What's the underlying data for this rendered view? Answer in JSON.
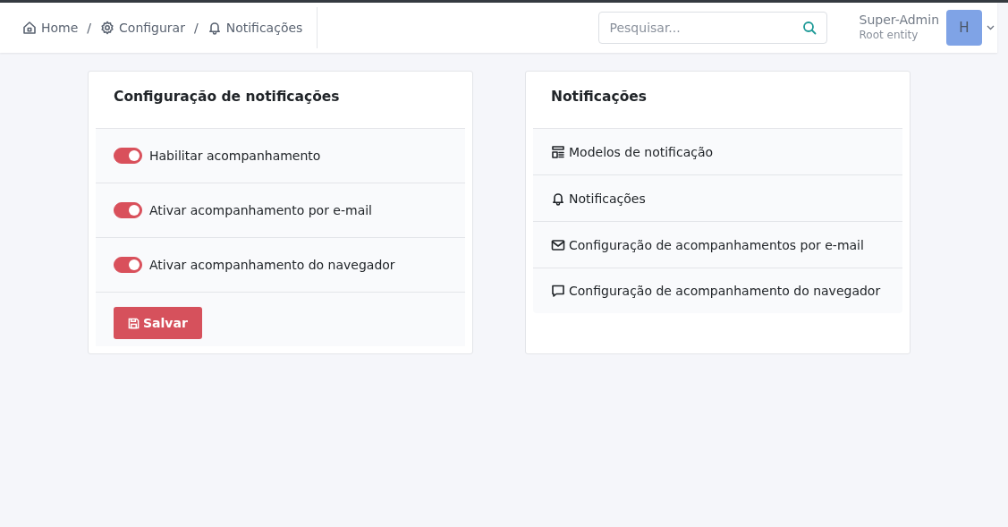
{
  "breadcrumb": [
    {
      "kind": "home",
      "label": "Home"
    },
    {
      "kind": "settings",
      "label": "Configurar"
    },
    {
      "kind": "bell",
      "label": "Notificações"
    }
  ],
  "breadcrumb_separator": "/",
  "search": {
    "placeholder": "Pesquisar..."
  },
  "user": {
    "name": "Super-Admin",
    "entity": "Root entity",
    "avatar": "H"
  },
  "settings_card": {
    "title": "Configuração de notificações",
    "toggles": [
      {
        "label": "Habilitar acompanhamento",
        "on": true
      },
      {
        "label": "Ativar acompanhamento por e-mail",
        "on": true
      },
      {
        "label": "Ativar acompanhamento do navegador",
        "on": true
      }
    ],
    "save_button": "Salvar"
  },
  "links_card": {
    "title": "Notificações",
    "items": [
      {
        "kind": "templates",
        "label": "Modelos de notificação"
      },
      {
        "kind": "bell",
        "label": "Notificações"
      },
      {
        "kind": "mail",
        "label": "Configuração de acompanhamentos por e-mail"
      },
      {
        "kind": "chat",
        "label": "Configuração de acompanhamento do navegador"
      }
    ]
  }
}
